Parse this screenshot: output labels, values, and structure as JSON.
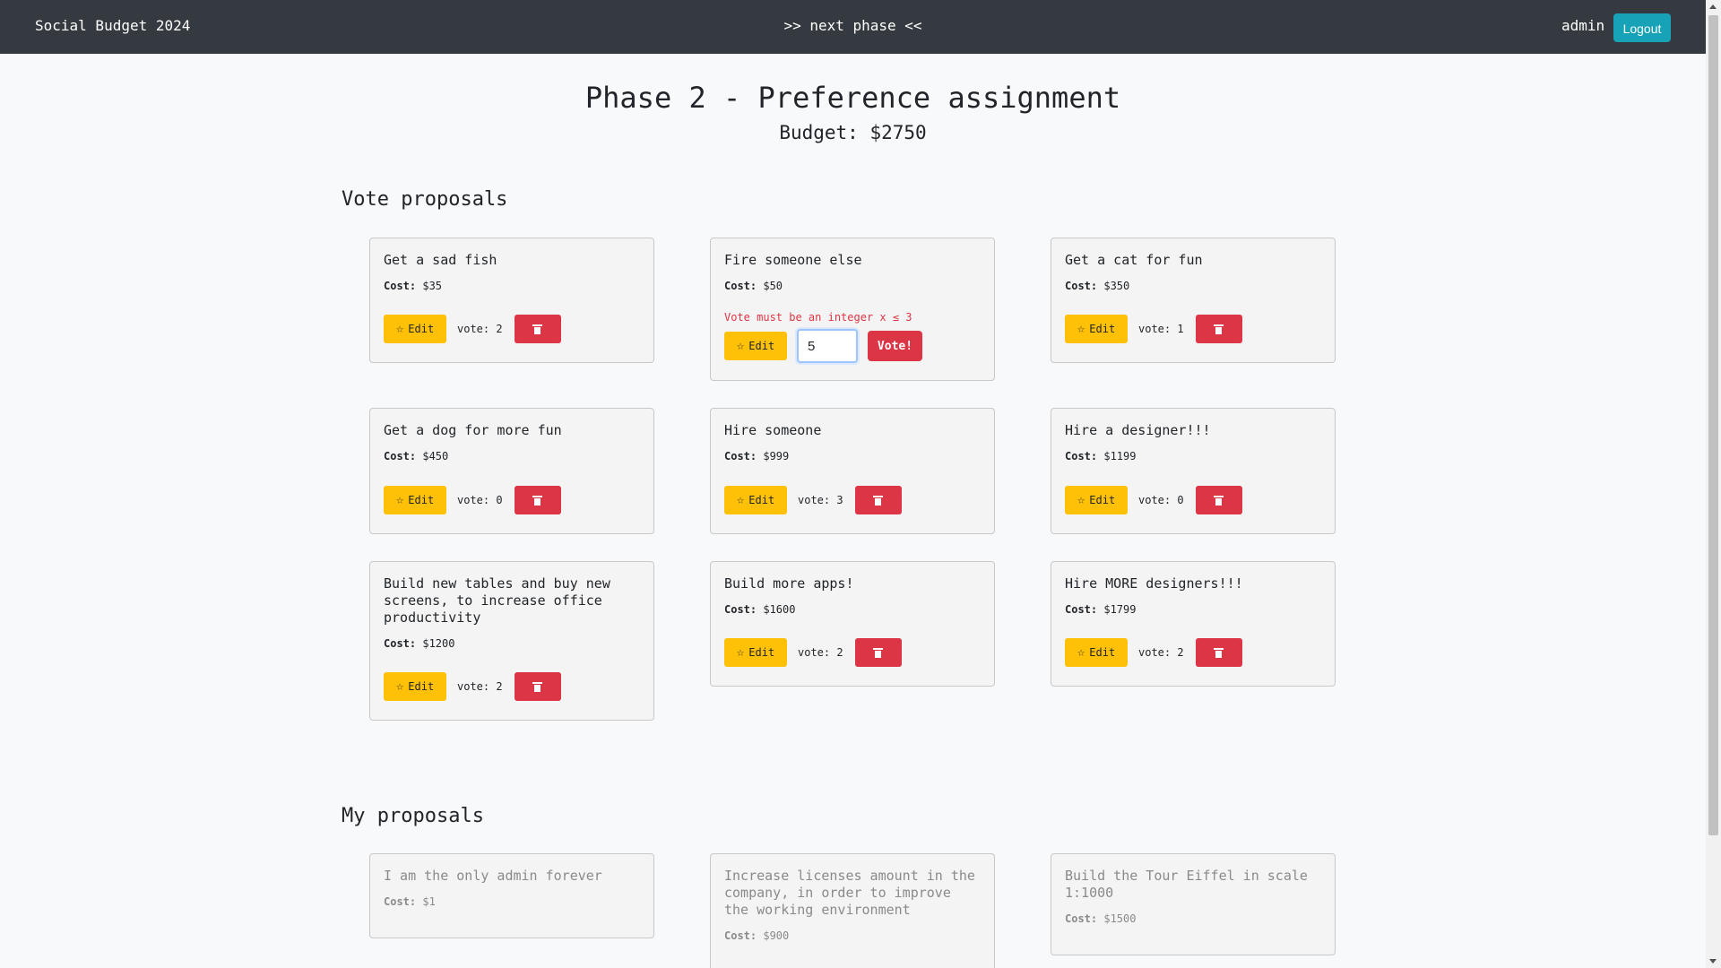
{
  "header": {
    "brand": "Social Budget 2024",
    "center_link": ">> next phase <<",
    "user": "admin",
    "logout_label": "Logout"
  },
  "main": {
    "title": "Phase 2 - Preference assignment",
    "budget": "Budget: $2750"
  },
  "vote_section": {
    "title": "Vote proposals",
    "edit_label": "Edit",
    "cost_label": "Cost:",
    "items": [
      {
        "title": "Get a sad fish",
        "cost": "$35",
        "vote": "vote: 2"
      },
      {
        "title": "Fire someone else",
        "cost": "$50",
        "error": "Vote must be an integer x ≤ 3",
        "input_value": "5",
        "vote_button": "Vote!"
      },
      {
        "title": "Get a cat for fun",
        "cost": "$350",
        "vote": "vote: 1"
      },
      {
        "title": "Get a dog for more fun",
        "cost": "$450",
        "vote": "vote: 0"
      },
      {
        "title": "Hire someone",
        "cost": "$999",
        "vote": "vote: 3"
      },
      {
        "title": "Hire a designer!!!",
        "cost": "$1199",
        "vote": "vote: 0"
      },
      {
        "title": "Build new tables and buy new screens, to increase office productivity",
        "cost": "$1200",
        "vote": "vote: 2"
      },
      {
        "title": "Build more apps!",
        "cost": "$1600",
        "vote": "vote: 2"
      },
      {
        "title": "Hire MORE designers!!!",
        "cost": "$1799",
        "vote": "vote: 2"
      }
    ]
  },
  "my_section": {
    "title": "My proposals",
    "items": [
      {
        "title": "I am the only admin forever",
        "cost": "$1"
      },
      {
        "title": "Increase licenses amount in the company, in order to improve the working environment",
        "cost": "$900"
      },
      {
        "title": "Build the Tour Eiffel in scale 1:1000",
        "cost": "$1500"
      }
    ]
  },
  "icons": {
    "edit": "star-icon",
    "delete": "trash-icon"
  },
  "colors": {
    "navbar": "#343a40",
    "edit_button": "#ffc107",
    "delete_button": "#dc3545",
    "logout_button": "#17a2b8"
  }
}
